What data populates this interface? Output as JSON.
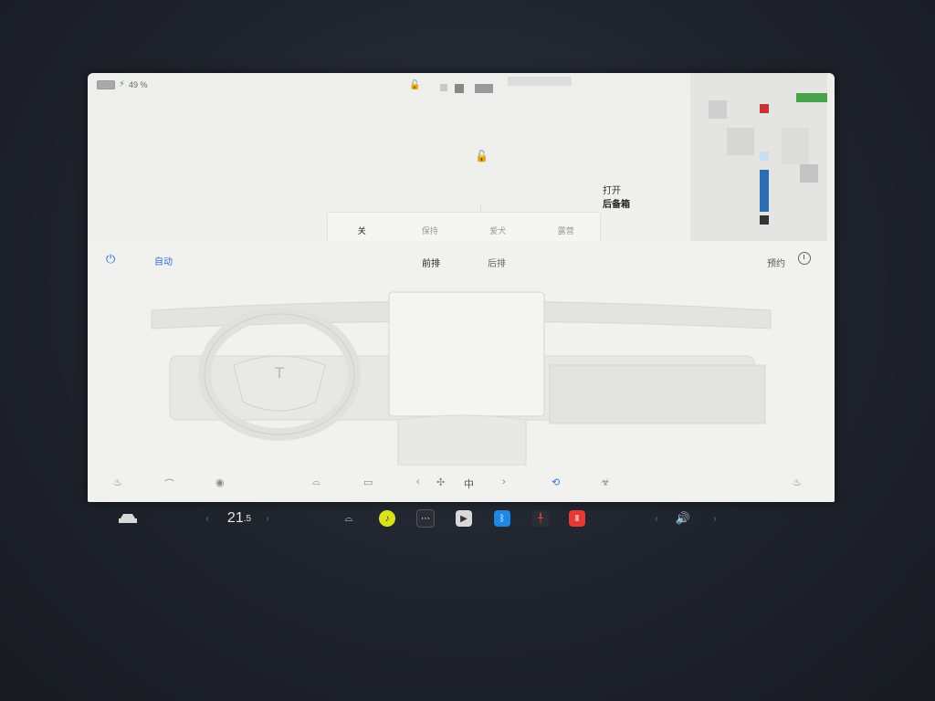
{
  "status_bar": {
    "battery": "49 %"
  },
  "top": {
    "trunk_line1": "打开",
    "trunk_line2": "后备箱",
    "modes": [
      {
        "label": "关",
        "selected": true
      },
      {
        "label": "保持",
        "selected": false
      },
      {
        "label": "爱犬",
        "selected": false
      },
      {
        "label": "露营",
        "selected": false
      }
    ]
  },
  "climate": {
    "auto_label": "自动",
    "front_label": "前排",
    "rear_label": "后排",
    "schedule_label": "预约",
    "fan_speed": "中"
  },
  "dock": {
    "temperature": "21",
    "temperature_decimal": ".5"
  },
  "colors": {
    "accent": "#2d72d9",
    "screen_bg": "#eeeeec",
    "bezel": "#1f232c"
  }
}
